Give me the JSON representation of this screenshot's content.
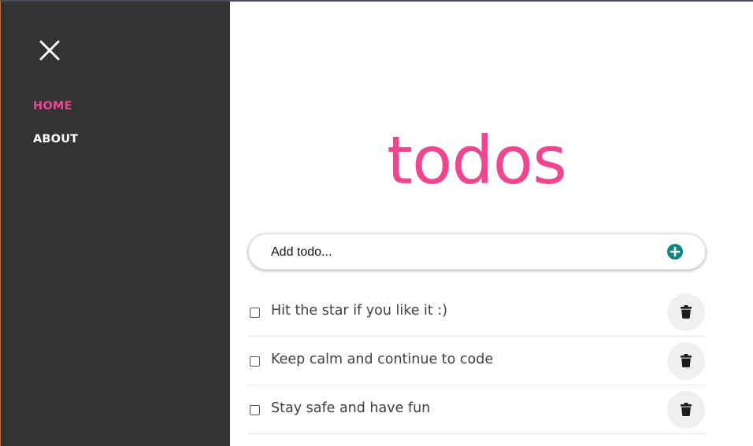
{
  "sidebar": {
    "close_icon": "close-icon",
    "nav": [
      {
        "label": "HOME",
        "active": true
      },
      {
        "label": "ABOUT",
        "active": false
      }
    ]
  },
  "main": {
    "title": "todos",
    "add_todo": {
      "placeholder": "Add todo...",
      "button_icon": "plus-circle-icon"
    },
    "todos": [
      {
        "text": "Hit the star if you like it :)",
        "done": false,
        "delete_icon": "trash-icon"
      },
      {
        "text": "Keep calm and continue to code",
        "done": false,
        "delete_icon": "trash-icon"
      },
      {
        "text": "Stay safe and have fun",
        "done": false,
        "delete_icon": "trash-icon"
      }
    ]
  },
  "colors": {
    "accent": "#f0468f",
    "sidebar_bg": "#333333",
    "add_button": "#12857e",
    "delete_button_bg": "#f0f0f2"
  }
}
